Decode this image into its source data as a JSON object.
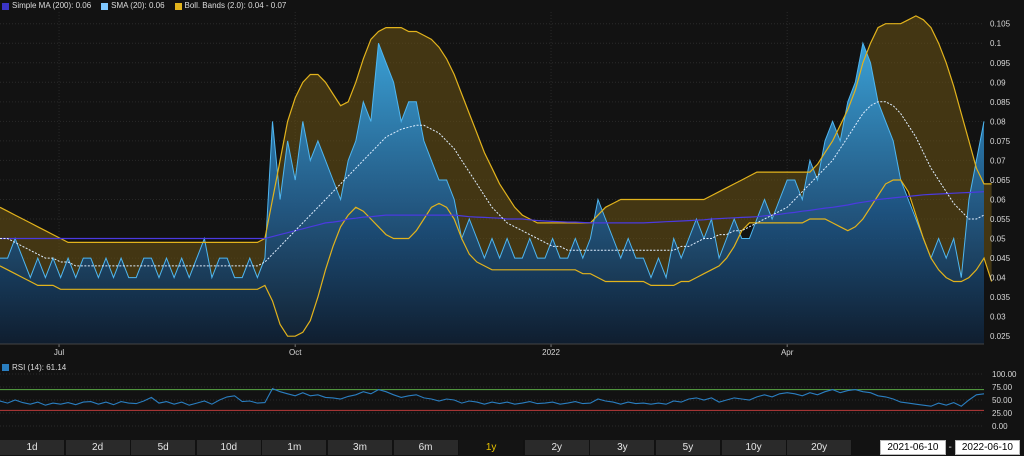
{
  "legend": [
    {
      "label": "Simple MA (200): 0.06",
      "color": "#3b35c8"
    },
    {
      "label": "SMA (20): 0.06",
      "color": "#7fc8ff"
    },
    {
      "label": "Boll. Bands (2.0): 0.04 - 0.07",
      "color": "#e2b31c"
    }
  ],
  "rsi_legend": {
    "label": "RSI (14): 61.14",
    "color": "#2a7ec0"
  },
  "range_buttons": [
    "1d",
    "2d",
    "5d",
    "10d",
    "1m",
    "3m",
    "6m",
    "1y",
    "2y",
    "3y",
    "5y",
    "10y",
    "20y"
  ],
  "active_range": "1y",
  "date_from": "2021-06-10",
  "date_sep": "-",
  "date_to": "2022-06-10",
  "chart_data": [
    {
      "type": "area",
      "x_ticks": [
        "Jul",
        "Oct",
        "2022",
        "Apr"
      ],
      "y_ticks": [
        "0.025",
        "0.03",
        "0.035",
        "0.04",
        "0.045",
        "0.05",
        "0.055",
        "0.06",
        "0.065",
        "0.07",
        "0.075",
        "0.08",
        "0.085",
        "0.09",
        "0.095",
        "0.1",
        "0.105"
      ],
      "ylim": [
        0.023,
        0.108
      ],
      "grid": true,
      "series": [
        {
          "name": "Price",
          "values": [
            0.045,
            0.045,
            0.05,
            0.045,
            0.04,
            0.045,
            0.04,
            0.045,
            0.04,
            0.045,
            0.04,
            0.045,
            0.045,
            0.04,
            0.045,
            0.04,
            0.045,
            0.04,
            0.04,
            0.045,
            0.045,
            0.04,
            0.045,
            0.04,
            0.045,
            0.04,
            0.045,
            0.05,
            0.04,
            0.045,
            0.045,
            0.04,
            0.04,
            0.045,
            0.04,
            0.045,
            0.08,
            0.06,
            0.075,
            0.065,
            0.08,
            0.07,
            0.075,
            0.07,
            0.065,
            0.06,
            0.07,
            0.075,
            0.085,
            0.08,
            0.1,
            0.095,
            0.09,
            0.08,
            0.085,
            0.085,
            0.075,
            0.07,
            0.065,
            0.065,
            0.06,
            0.05,
            0.055,
            0.05,
            0.045,
            0.05,
            0.045,
            0.05,
            0.045,
            0.045,
            0.05,
            0.045,
            0.045,
            0.05,
            0.045,
            0.045,
            0.05,
            0.045,
            0.05,
            0.06,
            0.055,
            0.05,
            0.045,
            0.05,
            0.045,
            0.045,
            0.04,
            0.045,
            0.04,
            0.05,
            0.045,
            0.05,
            0.055,
            0.05,
            0.055,
            0.045,
            0.05,
            0.055,
            0.05,
            0.05,
            0.055,
            0.06,
            0.055,
            0.06,
            0.065,
            0.065,
            0.06,
            0.07,
            0.065,
            0.075,
            0.08,
            0.075,
            0.085,
            0.09,
            0.1,
            0.095,
            0.085,
            0.08,
            0.075,
            0.065,
            0.06,
            0.055,
            0.05,
            0.045,
            0.05,
            0.045,
            0.05,
            0.04,
            0.06,
            0.07,
            0.08
          ]
        },
        {
          "name": "Simple MA (200)",
          "values": [
            0.05,
            0.05,
            0.05,
            0.05,
            0.05,
            0.05,
            0.05,
            0.05,
            0.05,
            0.05,
            0.05,
            0.05,
            0.05,
            0.05,
            0.05,
            0.05,
            0.05,
            0.05,
            0.05,
            0.05,
            0.05,
            0.05,
            0.05,
            0.05,
            0.05,
            0.05,
            0.05,
            0.05,
            0.05,
            0.05,
            0.05,
            0.05,
            0.05,
            0.05,
            0.05,
            0.05,
            0.0505,
            0.051,
            0.0515,
            0.052,
            0.0525,
            0.053,
            0.0535,
            0.054,
            0.0542,
            0.0545,
            0.055,
            0.0552,
            0.0555,
            0.0556,
            0.0558,
            0.056,
            0.056,
            0.056,
            0.056,
            0.056,
            0.056,
            0.056,
            0.056,
            0.056,
            0.056,
            0.0558,
            0.0556,
            0.0555,
            0.0554,
            0.0553,
            0.0552,
            0.055,
            0.055,
            0.055,
            0.0548,
            0.0546,
            0.0545,
            0.0544,
            0.0543,
            0.0542,
            0.0542,
            0.0541,
            0.054,
            0.054,
            0.054,
            0.054,
            0.054,
            0.054,
            0.054,
            0.054,
            0.0541,
            0.0542,
            0.0543,
            0.0544,
            0.0545,
            0.0546,
            0.0547,
            0.0548,
            0.055,
            0.0551,
            0.0552,
            0.0553,
            0.0554,
            0.0555,
            0.0556,
            0.0558,
            0.056,
            0.0562,
            0.0565,
            0.0567,
            0.057,
            0.0572,
            0.0575,
            0.0578,
            0.058,
            0.0583,
            0.0586,
            0.059,
            0.0593,
            0.0596,
            0.06,
            0.0602,
            0.0604,
            0.0606,
            0.0608,
            0.061,
            0.0612,
            0.0613,
            0.0614,
            0.0615,
            0.0616,
            0.0617,
            0.0618,
            0.0619,
            0.062
          ]
        },
        {
          "name": "SMA (20)",
          "values": [
            0.05,
            0.05,
            0.049,
            0.048,
            0.047,
            0.046,
            0.045,
            0.045,
            0.044,
            0.044,
            0.043,
            0.043,
            0.043,
            0.043,
            0.043,
            0.043,
            0.043,
            0.043,
            0.043,
            0.043,
            0.043,
            0.043,
            0.043,
            0.043,
            0.043,
            0.043,
            0.043,
            0.043,
            0.043,
            0.043,
            0.043,
            0.043,
            0.043,
            0.043,
            0.043,
            0.044,
            0.046,
            0.048,
            0.05,
            0.052,
            0.054,
            0.056,
            0.058,
            0.06,
            0.062,
            0.064,
            0.066,
            0.068,
            0.07,
            0.072,
            0.074,
            0.076,
            0.077,
            0.078,
            0.0785,
            0.079,
            0.079,
            0.078,
            0.077,
            0.075,
            0.073,
            0.07,
            0.067,
            0.064,
            0.061,
            0.058,
            0.056,
            0.054,
            0.053,
            0.052,
            0.051,
            0.05,
            0.049,
            0.048,
            0.048,
            0.047,
            0.047,
            0.047,
            0.047,
            0.047,
            0.047,
            0.047,
            0.047,
            0.047,
            0.047,
            0.047,
            0.047,
            0.047,
            0.047,
            0.047,
            0.048,
            0.048,
            0.049,
            0.05,
            0.05,
            0.051,
            0.051,
            0.052,
            0.052,
            0.053,
            0.054,
            0.055,
            0.056,
            0.057,
            0.058,
            0.06,
            0.062,
            0.064,
            0.066,
            0.068,
            0.07,
            0.073,
            0.076,
            0.079,
            0.082,
            0.084,
            0.085,
            0.085,
            0.084,
            0.082,
            0.079,
            0.076,
            0.072,
            0.068,
            0.065,
            0.062,
            0.059,
            0.057,
            0.055,
            0.055,
            0.056
          ]
        },
        {
          "name": "Boll. Upper",
          "values": [
            0.058,
            0.057,
            0.056,
            0.055,
            0.054,
            0.053,
            0.052,
            0.051,
            0.05,
            0.049,
            0.049,
            0.049,
            0.049,
            0.049,
            0.049,
            0.049,
            0.049,
            0.049,
            0.049,
            0.049,
            0.049,
            0.049,
            0.049,
            0.049,
            0.049,
            0.049,
            0.049,
            0.049,
            0.049,
            0.049,
            0.049,
            0.049,
            0.049,
            0.049,
            0.049,
            0.05,
            0.06,
            0.07,
            0.08,
            0.086,
            0.09,
            0.092,
            0.092,
            0.09,
            0.087,
            0.084,
            0.085,
            0.09,
            0.096,
            0.101,
            0.103,
            0.104,
            0.104,
            0.104,
            0.103,
            0.103,
            0.102,
            0.101,
            0.099,
            0.096,
            0.092,
            0.087,
            0.082,
            0.077,
            0.072,
            0.068,
            0.064,
            0.061,
            0.058,
            0.056,
            0.055,
            0.054,
            0.054,
            0.054,
            0.054,
            0.054,
            0.054,
            0.054,
            0.054,
            0.056,
            0.058,
            0.059,
            0.06,
            0.06,
            0.06,
            0.06,
            0.06,
            0.06,
            0.06,
            0.06,
            0.06,
            0.06,
            0.06,
            0.06,
            0.061,
            0.062,
            0.063,
            0.064,
            0.065,
            0.066,
            0.067,
            0.067,
            0.067,
            0.067,
            0.067,
            0.067,
            0.067,
            0.067,
            0.069,
            0.072,
            0.075,
            0.079,
            0.083,
            0.088,
            0.095,
            0.1,
            0.104,
            0.105,
            0.105,
            0.105,
            0.106,
            0.107,
            0.106,
            0.104,
            0.1,
            0.095,
            0.089,
            0.082,
            0.075,
            0.068,
            0.064,
            0.064
          ]
        },
        {
          "name": "Boll. Lower",
          "values": [
            0.043,
            0.042,
            0.041,
            0.04,
            0.039,
            0.038,
            0.038,
            0.038,
            0.037,
            0.037,
            0.037,
            0.037,
            0.037,
            0.037,
            0.037,
            0.037,
            0.037,
            0.037,
            0.037,
            0.037,
            0.037,
            0.037,
            0.037,
            0.037,
            0.037,
            0.037,
            0.037,
            0.037,
            0.037,
            0.037,
            0.037,
            0.037,
            0.037,
            0.037,
            0.037,
            0.038,
            0.034,
            0.028,
            0.025,
            0.025,
            0.026,
            0.029,
            0.035,
            0.042,
            0.048,
            0.053,
            0.056,
            0.058,
            0.057,
            0.055,
            0.053,
            0.051,
            0.05,
            0.05,
            0.05,
            0.052,
            0.055,
            0.058,
            0.059,
            0.058,
            0.055,
            0.05,
            0.046,
            0.044,
            0.043,
            0.042,
            0.042,
            0.042,
            0.042,
            0.042,
            0.042,
            0.042,
            0.042,
            0.042,
            0.042,
            0.042,
            0.042,
            0.041,
            0.041,
            0.04,
            0.039,
            0.039,
            0.039,
            0.039,
            0.039,
            0.039,
            0.038,
            0.038,
            0.038,
            0.038,
            0.039,
            0.039,
            0.04,
            0.041,
            0.042,
            0.043,
            0.045,
            0.048,
            0.052,
            0.054,
            0.054,
            0.054,
            0.054,
            0.054,
            0.054,
            0.054,
            0.054,
            0.055,
            0.055,
            0.055,
            0.054,
            0.053,
            0.052,
            0.053,
            0.055,
            0.058,
            0.061,
            0.064,
            0.065,
            0.065,
            0.062,
            0.056,
            0.05,
            0.045,
            0.042,
            0.04,
            0.039,
            0.039,
            0.04,
            0.042,
            0.045,
            0.039
          ]
        }
      ]
    },
    {
      "type": "line",
      "title": "RSI (14): 61.14",
      "y_ticks": [
        "100.00",
        "75.00",
        "50.00",
        "25.00",
        "0.00"
      ],
      "ylim": [
        0,
        100
      ],
      "reference_lines": [
        {
          "y": 70,
          "color": "#5aa844"
        },
        {
          "y": 30,
          "color": "#b83a3a"
        }
      ],
      "series": [
        {
          "name": "RSI (14)",
          "values": [
            48,
            44,
            50,
            45,
            42,
            46,
            40,
            44,
            42,
            45,
            41,
            46,
            47,
            42,
            46,
            41,
            47,
            44,
            43,
            48,
            55,
            44,
            47,
            42,
            46,
            40,
            44,
            48,
            42,
            50,
            56,
            58,
            47,
            48,
            44,
            45,
            72,
            66,
            62,
            58,
            64,
            58,
            60,
            55,
            54,
            52,
            57,
            60,
            66,
            62,
            70,
            66,
            60,
            55,
            58,
            60,
            54,
            52,
            48,
            52,
            50,
            44,
            48,
            46,
            42,
            46,
            43,
            46,
            42,
            44,
            47,
            43,
            44,
            46,
            42,
            44,
            47,
            43,
            44,
            52,
            48,
            46,
            42,
            46,
            43,
            44,
            42,
            44,
            42,
            48,
            46,
            52,
            54,
            50,
            54,
            46,
            50,
            54,
            52,
            50,
            56,
            60,
            56,
            62,
            64,
            62,
            58,
            64,
            60,
            66,
            70,
            64,
            68,
            70,
            66,
            64,
            58,
            56,
            52,
            46,
            44,
            42,
            40,
            38,
            44,
            40,
            45,
            38,
            50,
            60,
            62
          ]
        }
      ]
    }
  ]
}
